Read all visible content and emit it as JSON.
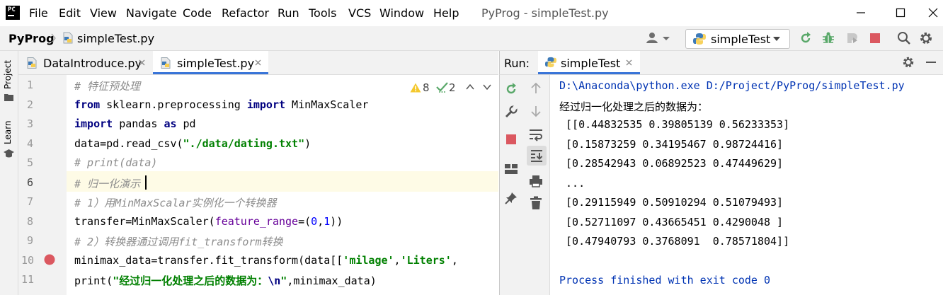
{
  "window": {
    "title": "PyProg - simpleTest.py",
    "menu": [
      "File",
      "Edit",
      "View",
      "Navigate",
      "Code",
      "Refactor",
      "Run",
      "Tools",
      "VCS",
      "Window",
      "Help"
    ]
  },
  "nav": {
    "project": "PyProg",
    "file": "simpleTest.py",
    "run_config": "simpleTest"
  },
  "sidebar": {
    "project_tab": "Project",
    "learn_tab": "Learn"
  },
  "editor": {
    "tabs": [
      {
        "label": "DataIntroduce.py",
        "active": false
      },
      {
        "label": "simpleTest.py",
        "active": true
      }
    ],
    "inspections": {
      "warnings": "8",
      "weak_warnings": "2"
    },
    "line_numbers": [
      "1",
      "2",
      "3",
      "4",
      "5",
      "6",
      "7",
      "8",
      "9",
      "10",
      "11"
    ],
    "current_line": "6",
    "breakpoint_line": "10",
    "lines": [
      [
        {
          "t": "# 特征预处理",
          "c": "cm"
        }
      ],
      [
        {
          "t": "from",
          "c": "kw"
        },
        {
          "t": " sklearn.preprocessing ",
          "c": ""
        },
        {
          "t": "import",
          "c": "kw"
        },
        {
          "t": " MinMaxScaler",
          "c": ""
        }
      ],
      [
        {
          "t": "import",
          "c": "kw"
        },
        {
          "t": " pandas ",
          "c": ""
        },
        {
          "t": "as",
          "c": "kw"
        },
        {
          "t": " pd",
          "c": ""
        }
      ],
      [
        {
          "t": "data=pd.read_csv(",
          "c": ""
        },
        {
          "t": "\"./data/dating.txt\"",
          "c": "str"
        },
        {
          "t": ")",
          "c": ""
        }
      ],
      [
        {
          "t": "# print(data)",
          "c": "cm"
        }
      ],
      [
        {
          "t": "# 归一化演示",
          "c": "cm"
        }
      ],
      [
        {
          "t": "# 1）用MinMaxScalar实例化一个转换器",
          "c": "cm"
        }
      ],
      [
        {
          "t": "transfer=MinMaxScaler(",
          "c": ""
        },
        {
          "t": "feature_range",
          "c": "param"
        },
        {
          "t": "=(",
          "c": ""
        },
        {
          "t": "0",
          "c": "num"
        },
        {
          "t": ",",
          "c": ""
        },
        {
          "t": "1",
          "c": "num"
        },
        {
          "t": "))",
          "c": ""
        }
      ],
      [
        {
          "t": "# 2）转换器通过调用fit_transform转换",
          "c": "cm"
        }
      ],
      [
        {
          "t": "minimax_data=transfer.fit_transform(data[[",
          "c": ""
        },
        {
          "t": "'milage'",
          "c": "str"
        },
        {
          "t": ",",
          "c": ""
        },
        {
          "t": "'Liters'",
          "c": "str"
        },
        {
          "t": ",",
          "c": ""
        }
      ],
      [
        {
          "t": "print(",
          "c": ""
        },
        {
          "t": "\"经过归一化处理之后的数据为：",
          "c": "str"
        },
        {
          "t": "\\n",
          "c": "kw"
        },
        {
          "t": "\"",
          "c": "str"
        },
        {
          "t": ",minimax_data)",
          "c": ""
        }
      ]
    ]
  },
  "run": {
    "label": "Run:",
    "tab": "simpleTest",
    "output": [
      {
        "text": "D:\\Anaconda\\python.exe D:/Project/PyProg/simpleTest.py",
        "style": "blue"
      },
      {
        "text": "经过归一化处理之后的数据为：",
        "style": ""
      },
      {
        "text": " [[0.44832535 0.39805139 0.56233353]",
        "style": ""
      },
      {
        "text": " [0.15873259 0.34195467 0.98724416]",
        "style": ""
      },
      {
        "text": " [0.28542943 0.06892523 0.47449629]",
        "style": ""
      },
      {
        "text": " ...",
        "style": ""
      },
      {
        "text": " [0.29115949 0.50910294 0.51079493]",
        "style": ""
      },
      {
        "text": " [0.52711097 0.43665451 0.4290048 ]",
        "style": ""
      },
      {
        "text": " [0.47940793 0.3768091  0.78571804]]",
        "style": ""
      },
      {
        "text": "",
        "style": ""
      },
      {
        "text": "Process finished with exit code 0",
        "style": "blue"
      }
    ]
  },
  "colors": {
    "accent": "#3874d8",
    "current_line_bg": "#fefbe6",
    "breakpoint": "#db5860",
    "run_green": "#59a869"
  }
}
